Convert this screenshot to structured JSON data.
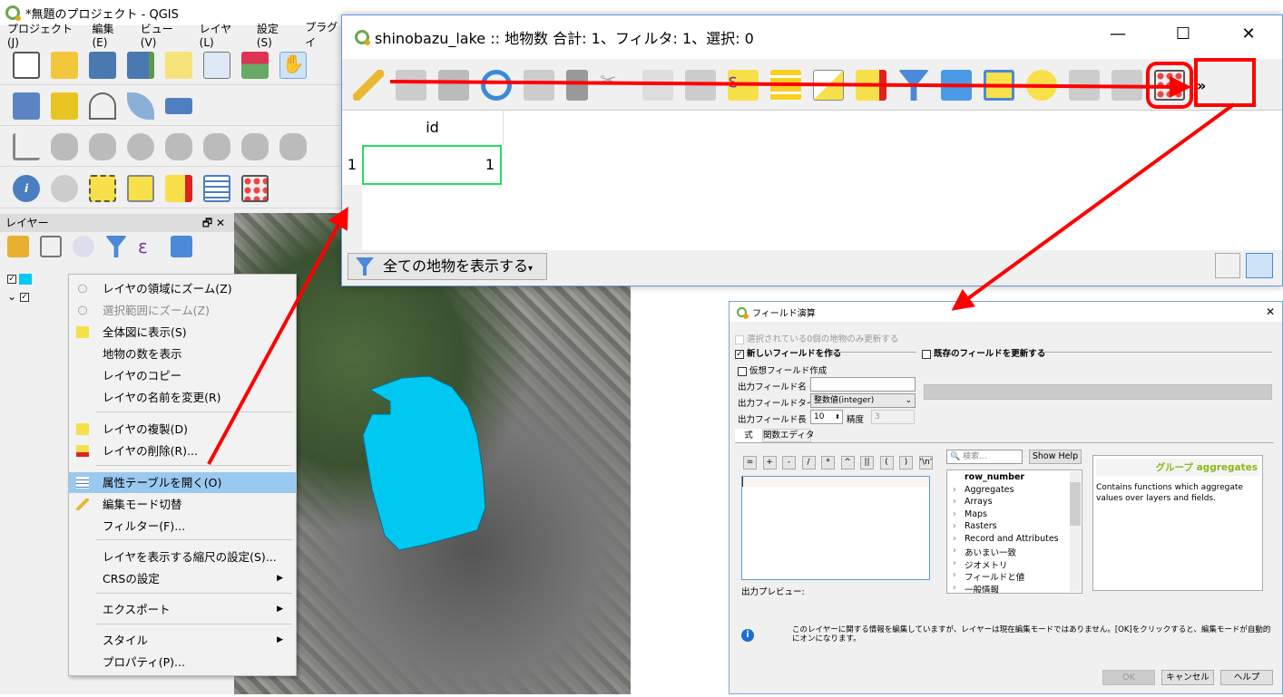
{
  "main_window": {
    "title": "*無題のプロジェクト - QGIS",
    "menu": [
      "プロジェクト(J)",
      "編集(E)",
      "ビュー(V)",
      "レイヤ(L)",
      "設定(S)",
      "プラグイ"
    ],
    "layers_panel": {
      "title": "レイヤー"
    }
  },
  "context_menu": {
    "items": [
      {
        "label": "レイヤの領域にズーム(Z)",
        "icon": "zoom-layer-icon"
      },
      {
        "label": "選択範囲にズーム(Z)",
        "icon": "zoom-selection-icon",
        "disabled": true
      },
      {
        "label": "全体図に表示(S)",
        "icon": "overview-icon"
      },
      {
        "label": "地物の数を表示"
      },
      {
        "label": "レイヤのコピー"
      },
      {
        "label": "レイヤの名前を変更(R)"
      },
      {
        "label": "レイヤの複製(D)",
        "icon": "duplicate-layer-icon"
      },
      {
        "label": "レイヤの削除(R)...",
        "icon": "remove-layer-icon"
      },
      {
        "label": "属性テーブルを開く(O)",
        "icon": "attribute-table-icon",
        "highlighted": true
      },
      {
        "label": "編集モード切替",
        "icon": "pencil-icon"
      },
      {
        "label": "フィルター(F)..."
      },
      {
        "label": "レイヤを表示する縮尺の設定(S)..."
      },
      {
        "label": "CRSの設定",
        "submenu": true
      },
      {
        "label": "エクスポート",
        "submenu": true
      },
      {
        "label": "スタイル",
        "submenu": true
      },
      {
        "label": "プロパティ(P)..."
      }
    ]
  },
  "attribute_table": {
    "title": "shinobazu_lake :: 地物数 合計: 1、フィルタ: 1、選択: 0",
    "columns": [
      "id"
    ],
    "rows": [
      {
        "row": "1",
        "id": "1"
      }
    ],
    "show_all_button": "全ての地物を表示する",
    "overflow": "»"
  },
  "field_calculator": {
    "title": "フィールド演算",
    "selected_only": "選択されている0個の地物のみ更新する",
    "create_new": "新しいフィールドを作る",
    "update_existing": "既存のフィールドを更新する",
    "virtual": "仮想フィールド作成",
    "name_label": "出力フィールド名",
    "name_value": "",
    "type_label": "出力フィールドタイプ",
    "type_value": "整数値(integer)",
    "length_label": "出力フィールド長",
    "length_value": "10",
    "precision_label": "精度",
    "precision_value": "3",
    "tabs": [
      "式",
      "関数エディタ"
    ],
    "operators": [
      "=",
      "+",
      "-",
      "/",
      "*",
      "^",
      "||",
      "(",
      ")",
      "'\\n'"
    ],
    "search_placeholder": "検索...",
    "show_help": "Show Help",
    "functions": [
      "row_number",
      "Aggregates",
      "Arrays",
      "Maps",
      "Rasters",
      "Record and Attributes",
      "あいまい一致",
      "ジオメトリ",
      "フィールドと値",
      "一般情報"
    ],
    "help_title": "グループ aggregates",
    "help_text": "Contains functions which aggregate values over layers and fields.",
    "preview_label": "出力プレビュー:",
    "info": "このレイヤーに関する情報を編集していますが、レイヤーは現在編集モードではありません。[OK]をクリックすると、編集モードが自動的にオンになります。",
    "ok": "OK",
    "cancel": "キャンセル",
    "help": "ヘルプ"
  },
  "colors": {
    "lake": "#00c8f0",
    "arrow": "#ff0000",
    "highlight": "#99c9ef",
    "help_title": "#8cb818",
    "cell_border": "#22dd66"
  }
}
